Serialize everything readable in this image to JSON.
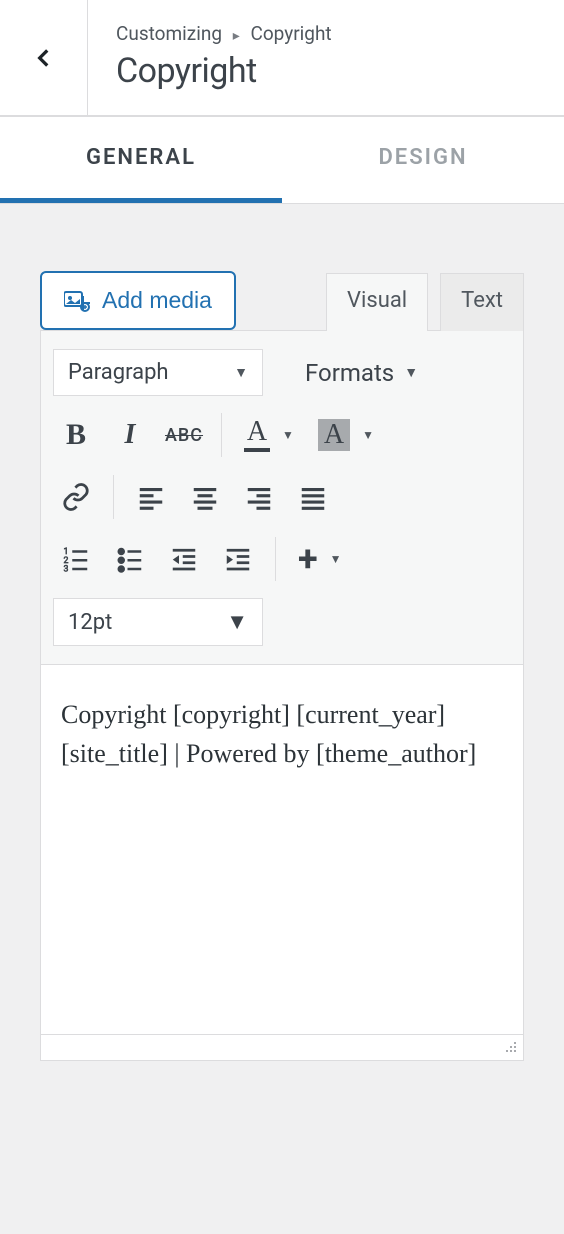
{
  "header": {
    "breadcrumb_prefix": "Customizing",
    "breadcrumb_current": "Copyright",
    "title": "Copyright"
  },
  "tabs": {
    "general": "GENERAL",
    "design": "DESIGN"
  },
  "editor": {
    "add_media_label": "Add media",
    "visual_tab": "Visual",
    "text_tab": "Text",
    "paragraph_select": "Paragraph",
    "formats_label": "Formats",
    "fontsize_select": "12pt",
    "content": "Copyright [copyright] [current_year] [site_title] | Powered by [theme_author]"
  },
  "toolbar": {
    "bold": "B",
    "italic": "I",
    "strike": "ABC",
    "textcolor": "A",
    "bgcolor": "A"
  }
}
